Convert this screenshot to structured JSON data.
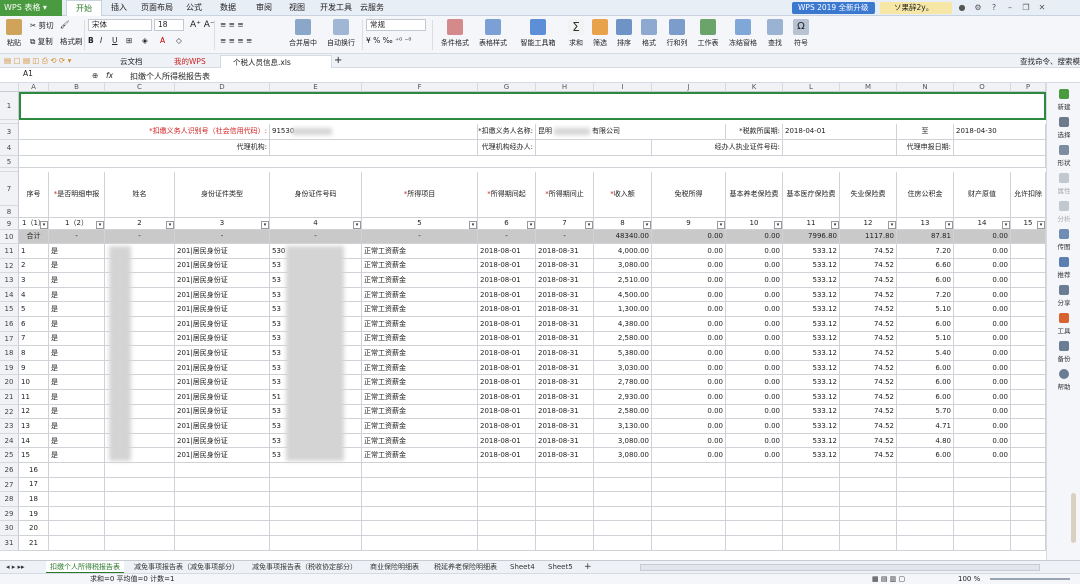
{
  "titlebar": {
    "app": "WPS 表格",
    "menus": [
      "开始",
      "插入",
      "页面布局",
      "公式",
      "数据",
      "审阅",
      "视图",
      "开发工具",
      "云服务"
    ],
    "upgrade": "WPS 2019 全新升级",
    "user": "ソ果辞2y。"
  },
  "ribbon": {
    "paste": "粘贴",
    "cut": "剪切",
    "copy": "复制",
    "format_painter": "格式刷",
    "font": "宋体",
    "font_size": "18",
    "number_format": "常规",
    "merge_center": "合并居中",
    "wrap": "自动换行",
    "cond_format": "条件格式",
    "table_style": "表格样式",
    "smart_toolbox": "智能工具箱",
    "sum": "求和",
    "filter": "筛选",
    "sort": "排序",
    "format": "格式",
    "row_col": "行和列",
    "worksheet": "工作表",
    "freeze": "冻结窗格",
    "find": "查找",
    "symbol": "符号",
    "accent": "#2b7a2b"
  },
  "tabs": {
    "items": [
      "云文档",
      "我的WPS",
      "个税人员信息.xls"
    ],
    "search": "查找命令、搜索模"
  },
  "formula": {
    "name_box": "A1",
    "fx": "fx",
    "content": "扣缴个人所得税报告表"
  },
  "columns": [
    "A",
    "B",
    "C",
    "D",
    "E",
    "F",
    "G",
    "H",
    "I",
    "J",
    "K",
    "L",
    "M",
    "N",
    "O",
    "P"
  ],
  "sheet": {
    "row3": {
      "tax_id_label": "*扣缴义务人识别号（社会信用代码）:",
      "tax_id_value": "91530",
      "name_label": "*扣缴义务人名称:",
      "name_value": "昆明",
      "name_suffix": "有限公司",
      "period_label": "*税款所属期:",
      "period_start": "2018-04-01",
      "to": "至",
      "period_end": "2018-04-30"
    },
    "row4": {
      "agency_label": "代理机构:",
      "agent_label": "代理机构经办人:",
      "cert_label": "经办人执业证件号码:",
      "date_label": "代理申报日期:"
    },
    "headers": [
      "序号",
      "*是否明细申报",
      "姓名",
      "身份证件类型",
      "身份证件号码",
      "*所得项目",
      "*所得期间起",
      "*所得期间止",
      "*收入额",
      "免税所得",
      "基本养老保险费",
      "基本医疗保险费",
      "失业保险费",
      "住房公积金",
      "财产原值",
      "允许扣除"
    ],
    "header_codes": [
      "1（1）",
      "1（2）",
      "2",
      "3",
      "4",
      "5",
      "6",
      "7",
      "8",
      "9",
      "10",
      "11",
      "12",
      "13",
      "14",
      "15"
    ],
    "total": {
      "label": "合计",
      "dash": "-",
      "income": "48340.00",
      "exempt": "0.00",
      "pension": "0.00",
      "medical": "7996.80",
      "unemp": "1117.80",
      "housing": "87.81",
      "property": "0.00"
    },
    "rows": [
      {
        "no": "1",
        "detail": "是",
        "idtype": "201|居民身份证",
        "id": "530",
        "item": "正常工资薪金",
        "start": "2018-08-01",
        "end": "2018-08-31",
        "income": "4,000.00",
        "exempt": "0.00",
        "pension": "0.00",
        "medical": "533.12",
        "unemp": "74.52",
        "housing": "7.20",
        "property": "0.00"
      },
      {
        "no": "2",
        "detail": "是",
        "idtype": "201|居民身份证",
        "id": "53",
        "item": "正常工资薪金",
        "start": "2018-08-01",
        "end": "2018-08-31",
        "income": "3,080.00",
        "exempt": "0.00",
        "pension": "0.00",
        "medical": "533.12",
        "unemp": "74.52",
        "housing": "6.60",
        "property": "0.00"
      },
      {
        "no": "3",
        "detail": "是",
        "idtype": "201|居民身份证",
        "id": "53",
        "item": "正常工资薪金",
        "start": "2018-08-01",
        "end": "2018-08-31",
        "income": "2,510.00",
        "exempt": "0.00",
        "pension": "0.00",
        "medical": "533.12",
        "unemp": "74.52",
        "housing": "6.00",
        "property": "0.00"
      },
      {
        "no": "4",
        "detail": "是",
        "idtype": "201|居民身份证",
        "id": "53",
        "item": "正常工资薪金",
        "start": "2018-08-01",
        "end": "2018-08-31",
        "income": "4,500.00",
        "exempt": "0.00",
        "pension": "0.00",
        "medical": "533.12",
        "unemp": "74.52",
        "housing": "7.20",
        "property": "0.00"
      },
      {
        "no": "5",
        "detail": "是",
        "idtype": "201|居民身份证",
        "id": "53",
        "item": "正常工资薪金",
        "start": "2018-08-01",
        "end": "2018-08-31",
        "income": "1,300.00",
        "exempt": "0.00",
        "pension": "0.00",
        "medical": "533.12",
        "unemp": "74.52",
        "housing": "5.10",
        "property": "0.00"
      },
      {
        "no": "6",
        "detail": "是",
        "idtype": "201|居民身份证",
        "id": "53",
        "item": "正常工资薪金",
        "start": "2018-08-01",
        "end": "2018-08-31",
        "income": "4,380.00",
        "exempt": "0.00",
        "pension": "0.00",
        "medical": "533.12",
        "unemp": "74.52",
        "housing": "6.00",
        "property": "0.00"
      },
      {
        "no": "7",
        "detail": "是",
        "idtype": "201|居民身份证",
        "id": "53",
        "item": "正常工资薪金",
        "start": "2018-08-01",
        "end": "2018-08-31",
        "income": "2,580.00",
        "exempt": "0.00",
        "pension": "0.00",
        "medical": "533.12",
        "unemp": "74.52",
        "housing": "5.10",
        "property": "0.00"
      },
      {
        "no": "8",
        "detail": "是",
        "idtype": "201|居民身份证",
        "id": "53",
        "item": "正常工资薪金",
        "start": "2018-08-01",
        "end": "2018-08-31",
        "income": "5,380.00",
        "exempt": "0.00",
        "pension": "0.00",
        "medical": "533.12",
        "unemp": "74.52",
        "housing": "5.40",
        "property": "0.00"
      },
      {
        "no": "9",
        "detail": "是",
        "idtype": "201|居民身份证",
        "id": "53",
        "item": "正常工资薪金",
        "start": "2018-08-01",
        "end": "2018-08-31",
        "income": "3,030.00",
        "exempt": "0.00",
        "pension": "0.00",
        "medical": "533.12",
        "unemp": "74.52",
        "housing": "6.00",
        "property": "0.00"
      },
      {
        "no": "10",
        "detail": "是",
        "idtype": "201|居民身份证",
        "id": "53",
        "item": "正常工资薪金",
        "start": "2018-08-01",
        "end": "2018-08-31",
        "income": "2,780.00",
        "exempt": "0.00",
        "pension": "0.00",
        "medical": "533.12",
        "unemp": "74.52",
        "housing": "6.00",
        "property": "0.00"
      },
      {
        "no": "11",
        "detail": "是",
        "idtype": "201|居民身份证",
        "id": "51",
        "item": "正常工资薪金",
        "start": "2018-08-01",
        "end": "2018-08-31",
        "income": "2,930.00",
        "exempt": "0.00",
        "pension": "0.00",
        "medical": "533.12",
        "unemp": "74.52",
        "housing": "6.00",
        "property": "0.00"
      },
      {
        "no": "12",
        "detail": "是",
        "idtype": "201|居民身份证",
        "id": "53",
        "item": "正常工资薪金",
        "start": "2018-08-01",
        "end": "2018-08-31",
        "income": "2,580.00",
        "exempt": "0.00",
        "pension": "0.00",
        "medical": "533.12",
        "unemp": "74.52",
        "housing": "5.70",
        "property": "0.00"
      },
      {
        "no": "13",
        "detail": "是",
        "idtype": "201|居民身份证",
        "id": "53",
        "item": "正常工资薪金",
        "start": "2018-08-01",
        "end": "2018-08-31",
        "income": "3,130.00",
        "exempt": "0.00",
        "pension": "0.00",
        "medical": "533.12",
        "unemp": "74.52",
        "housing": "4.71",
        "property": "0.00"
      },
      {
        "no": "14",
        "detail": "是",
        "idtype": "201|居民身份证",
        "id": "53",
        "item": "正常工资薪金",
        "start": "2018-08-01",
        "end": "2018-08-31",
        "income": "3,080.00",
        "exempt": "0.00",
        "pension": "0.00",
        "medical": "533.12",
        "unemp": "74.52",
        "housing": "4.80",
        "property": "0.00"
      },
      {
        "no": "15",
        "detail": "是",
        "idtype": "201|居民身份证",
        "id": "53",
        "item": "正常工资薪金",
        "start": "2018-08-01",
        "end": "2018-08-31",
        "income": "3,080.00",
        "exempt": "0.00",
        "pension": "0.00",
        "medical": "533.12",
        "unemp": "74.52",
        "housing": "6.00",
        "property": "0.00"
      }
    ],
    "empty_rows": [
      "16",
      "17",
      "18",
      "19",
      "20",
      "21"
    ]
  },
  "row_numbers": [
    "1",
    "3",
    "4",
    "5",
    "7",
    "8",
    "9",
    "10",
    "11",
    "12",
    "13",
    "14",
    "15",
    "16",
    "17",
    "18",
    "19",
    "20",
    "21",
    "22",
    "23",
    "24",
    "25",
    "26",
    "27",
    "28",
    "29",
    "30",
    "31"
  ],
  "right_panel": [
    "新建",
    "选择",
    "形状",
    "属性",
    "分析",
    "传图",
    "推荐",
    "分享",
    "工具",
    "备份",
    "帮助"
  ],
  "sheet_tabs": [
    "扣缴个人所得税报告表",
    "减免事项报告表（减免事项部分）",
    "减免事项报告表（税收协定部分）",
    "商业保险明细表",
    "税延养老保险明细表",
    "Sheet4",
    "Sheet5"
  ],
  "status": {
    "text": "求和=0  平均值=0  计数=1",
    "zoom": "100 %"
  }
}
